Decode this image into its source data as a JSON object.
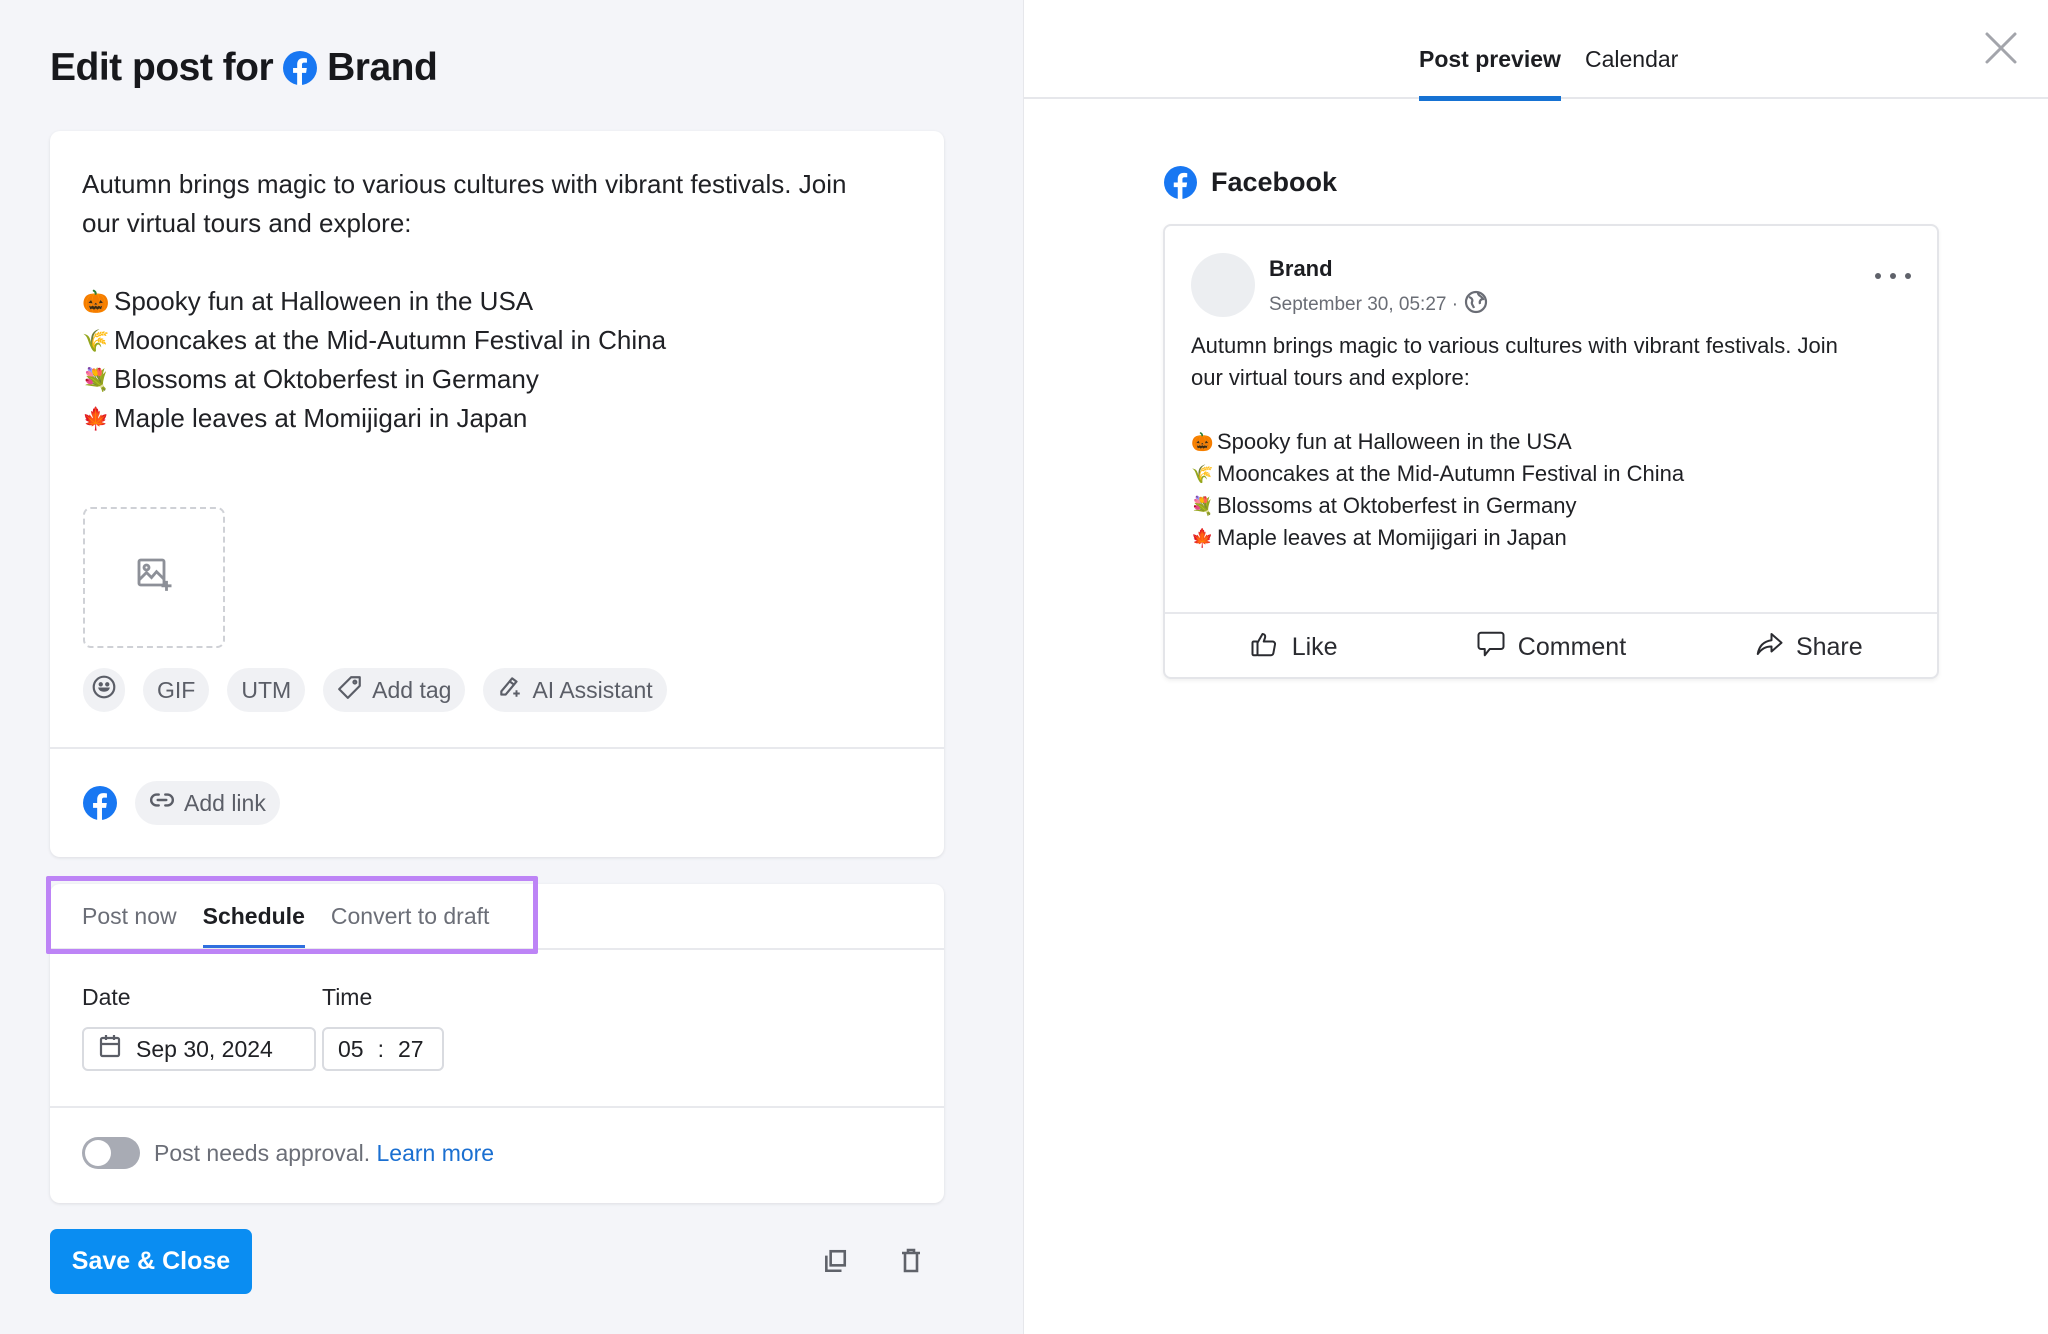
{
  "editor": {
    "title_prefix": "Edit post for",
    "title_account": "Brand",
    "post_intro_line1": "Autumn brings magic to various cultures with vibrant festivals. Join",
    "post_intro_line2": "our virtual tours and explore:",
    "post_items": [
      {
        "emoji": "🎃",
        "icon": "jack-o-lantern-icon",
        "text": "Spooky fun at Halloween in the USA"
      },
      {
        "emoji": "🌾",
        "icon": "rice-sheaf-icon",
        "text": "Mooncakes at the Mid-Autumn Festival in China"
      },
      {
        "emoji": "💐",
        "icon": "bouquet-icon",
        "text": "Blossoms at Oktoberfest in Germany"
      },
      {
        "emoji": "🍁",
        "icon": "maple-leaf-icon",
        "text": "Maple leaves at Momijigari in Japan"
      }
    ],
    "toolbar": {
      "gif_label": "GIF",
      "utm_label": "UTM",
      "add_tag_label": "Add tag",
      "ai_assistant_label": "AI Assistant"
    },
    "add_link_label": "Add link"
  },
  "publish": {
    "tabs": [
      {
        "label": "Post now",
        "active": false
      },
      {
        "label": "Schedule",
        "active": true
      },
      {
        "label": "Convert to draft",
        "active": false
      }
    ],
    "date_label": "Date",
    "time_label": "Time",
    "date_value": "Sep 30, 2024",
    "time_hour": "05",
    "time_separator": ":",
    "time_minute": "27",
    "approval_text": "Post needs approval.",
    "approval_link": "Learn more",
    "approval_enabled": false
  },
  "footer": {
    "save_label": "Save & Close"
  },
  "preview": {
    "tabs": [
      {
        "label": "Post preview",
        "active": true
      },
      {
        "label": "Calendar",
        "active": false
      }
    ],
    "network_name": "Facebook",
    "account_name": "Brand",
    "post_meta": "September 30, 05:27 ·",
    "post_intro_line1": "Autumn brings magic to various cultures with vibrant festivals. Join",
    "post_intro_line2": "our virtual tours and explore:",
    "actions": {
      "like": "Like",
      "comment": "Comment",
      "share": "Share"
    }
  },
  "colors": {
    "accent": "#0a8df2",
    "facebook": "#1877f2",
    "tab_underline": "#2f6fde",
    "highlight": "#bd84f6",
    "link": "#1a6fd1"
  }
}
